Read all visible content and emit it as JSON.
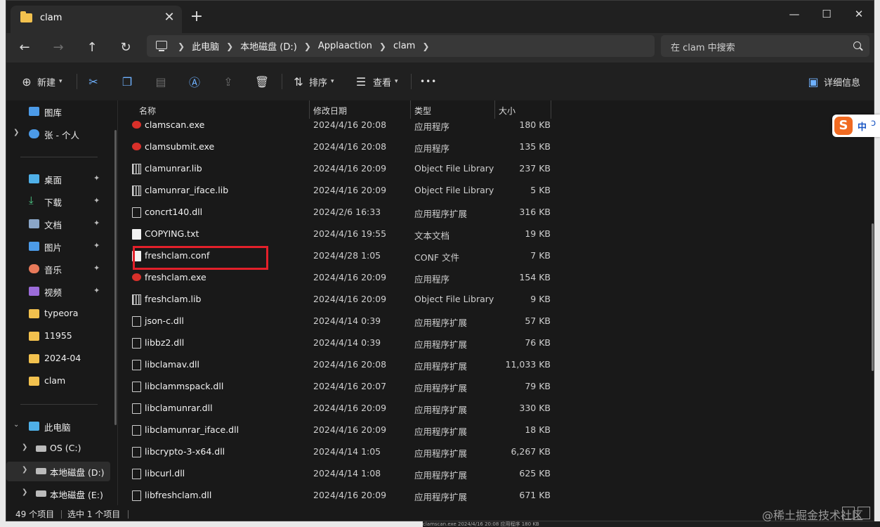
{
  "window": {
    "tab_title": "clam",
    "close_glyph": "✕",
    "newtab_glyph": "+",
    "minimize_glyph": "—",
    "maximize_glyph": "☐",
    "close_window_glyph": "✕"
  },
  "nav": {
    "breadcrumbs": [
      "此电脑",
      "本地磁盘 (D:)",
      "Applaaction",
      "clam"
    ],
    "search_placeholder": "在 clam 中搜索"
  },
  "toolbar": {
    "new_label": "新建",
    "sort_label": "排序",
    "view_label": "查看",
    "more_label": "•••",
    "details_label": "详细信息"
  },
  "sidebar": {
    "items": [
      {
        "label": "图库",
        "icon": "gallery-icon",
        "color": "#4c9be8"
      },
      {
        "label": "张 - 个人",
        "icon": "onedrive-icon",
        "color": "#4c9be8"
      },
      {
        "label": "桌面",
        "icon": "desktop-icon",
        "color": "#4fb0e8"
      },
      {
        "label": "下载",
        "icon": "download-icon",
        "color": "#4fd18b"
      },
      {
        "label": "文档",
        "icon": "documents-icon",
        "color": "#8aa6c8"
      },
      {
        "label": "图片",
        "icon": "pictures-icon",
        "color": "#4c9be8"
      },
      {
        "label": "音乐",
        "icon": "music-icon",
        "color": "#e87a5a"
      },
      {
        "label": "视频",
        "icon": "videos-icon",
        "color": "#9c6cd9"
      },
      {
        "label": "typeora",
        "icon": "folder-icon",
        "color": "#f2c14e"
      },
      {
        "label": "11955",
        "icon": "folder-icon",
        "color": "#f2c14e"
      },
      {
        "label": "2024-04",
        "icon": "folder-icon",
        "color": "#f2c14e"
      },
      {
        "label": "clam",
        "icon": "folder-icon",
        "color": "#f2c14e"
      },
      {
        "label": "此电脑",
        "icon": "computer-icon",
        "color": "#4fb0e8"
      },
      {
        "label": "OS (C:)",
        "icon": "drive-icon",
        "color": "#bbbbbb"
      },
      {
        "label": "本地磁盘 (D:)",
        "icon": "drive-icon",
        "color": "#bbbbbb"
      },
      {
        "label": "本地磁盘 (E:)",
        "icon": "drive-icon",
        "color": "#bbbbbb"
      }
    ],
    "pin_glyph": "📌"
  },
  "columns": {
    "name": "名称",
    "date": "修改日期",
    "type": "类型",
    "size": "大小"
  },
  "files": [
    {
      "name": "clamscan.exe",
      "date": "2024/4/16 20:08",
      "type": "应用程序",
      "size": "180 KB",
      "icon": "exe"
    },
    {
      "name": "clamsubmit.exe",
      "date": "2024/4/16 20:08",
      "type": "应用程序",
      "size": "135 KB",
      "icon": "exe"
    },
    {
      "name": "clamunrar.lib",
      "date": "2024/4/16 20:09",
      "type": "Object File Library",
      "size": "237 KB",
      "icon": "lib"
    },
    {
      "name": "clamunrar_iface.lib",
      "date": "2024/4/16 20:09",
      "type": "Object File Library",
      "size": "5 KB",
      "icon": "lib"
    },
    {
      "name": "concrt140.dll",
      "date": "2024/2/6 16:33",
      "type": "应用程序扩展",
      "size": "316 KB",
      "icon": "dll"
    },
    {
      "name": "COPYING.txt",
      "date": "2024/4/16 19:55",
      "type": "文本文档",
      "size": "19 KB",
      "icon": "txt"
    },
    {
      "name": "freshclam.conf",
      "date": "2024/4/28 1:05",
      "type": "CONF 文件",
      "size": "7 KB",
      "icon": "txt"
    },
    {
      "name": "freshclam.exe",
      "date": "2024/4/16 20:09",
      "type": "应用程序",
      "size": "154 KB",
      "icon": "exe"
    },
    {
      "name": "freshclam.lib",
      "date": "2024/4/16 20:09",
      "type": "Object File Library",
      "size": "9 KB",
      "icon": "lib"
    },
    {
      "name": "json-c.dll",
      "date": "2024/4/14 0:39",
      "type": "应用程序扩展",
      "size": "57 KB",
      "icon": "dll"
    },
    {
      "name": "libbz2.dll",
      "date": "2024/4/14 0:39",
      "type": "应用程序扩展",
      "size": "76 KB",
      "icon": "dll"
    },
    {
      "name": "libclamav.dll",
      "date": "2024/4/16 20:08",
      "type": "应用程序扩展",
      "size": "11,033 KB",
      "icon": "dll"
    },
    {
      "name": "libclammspack.dll",
      "date": "2024/4/16 20:07",
      "type": "应用程序扩展",
      "size": "79 KB",
      "icon": "dll"
    },
    {
      "name": "libclamunrar.dll",
      "date": "2024/4/16 20:09",
      "type": "应用程序扩展",
      "size": "330 KB",
      "icon": "dll"
    },
    {
      "name": "libclamunrar_iface.dll",
      "date": "2024/4/16 20:09",
      "type": "应用程序扩展",
      "size": "18 KB",
      "icon": "dll"
    },
    {
      "name": "libcrypto-3-x64.dll",
      "date": "2024/4/14 1:05",
      "type": "应用程序扩展",
      "size": "6,267 KB",
      "icon": "dll"
    },
    {
      "name": "libcurl.dll",
      "date": "2024/4/14 1:08",
      "type": "应用程序扩展",
      "size": "625 KB",
      "icon": "dll"
    },
    {
      "name": "libfreshclam.dll",
      "date": "2024/4/16 20:09",
      "type": "应用程序扩展",
      "size": "671 KB",
      "icon": "dll"
    }
  ],
  "status": {
    "count": "49 个项目",
    "selection": "选中 1 个项目"
  },
  "ime": {
    "logo": "S",
    "mode": "中",
    "punct": "ↄ"
  },
  "watermark": "@稀土掘金技术社区",
  "background_strip": "clamscan.exe          2024/4/16 20:08          应用程序          180 KB"
}
